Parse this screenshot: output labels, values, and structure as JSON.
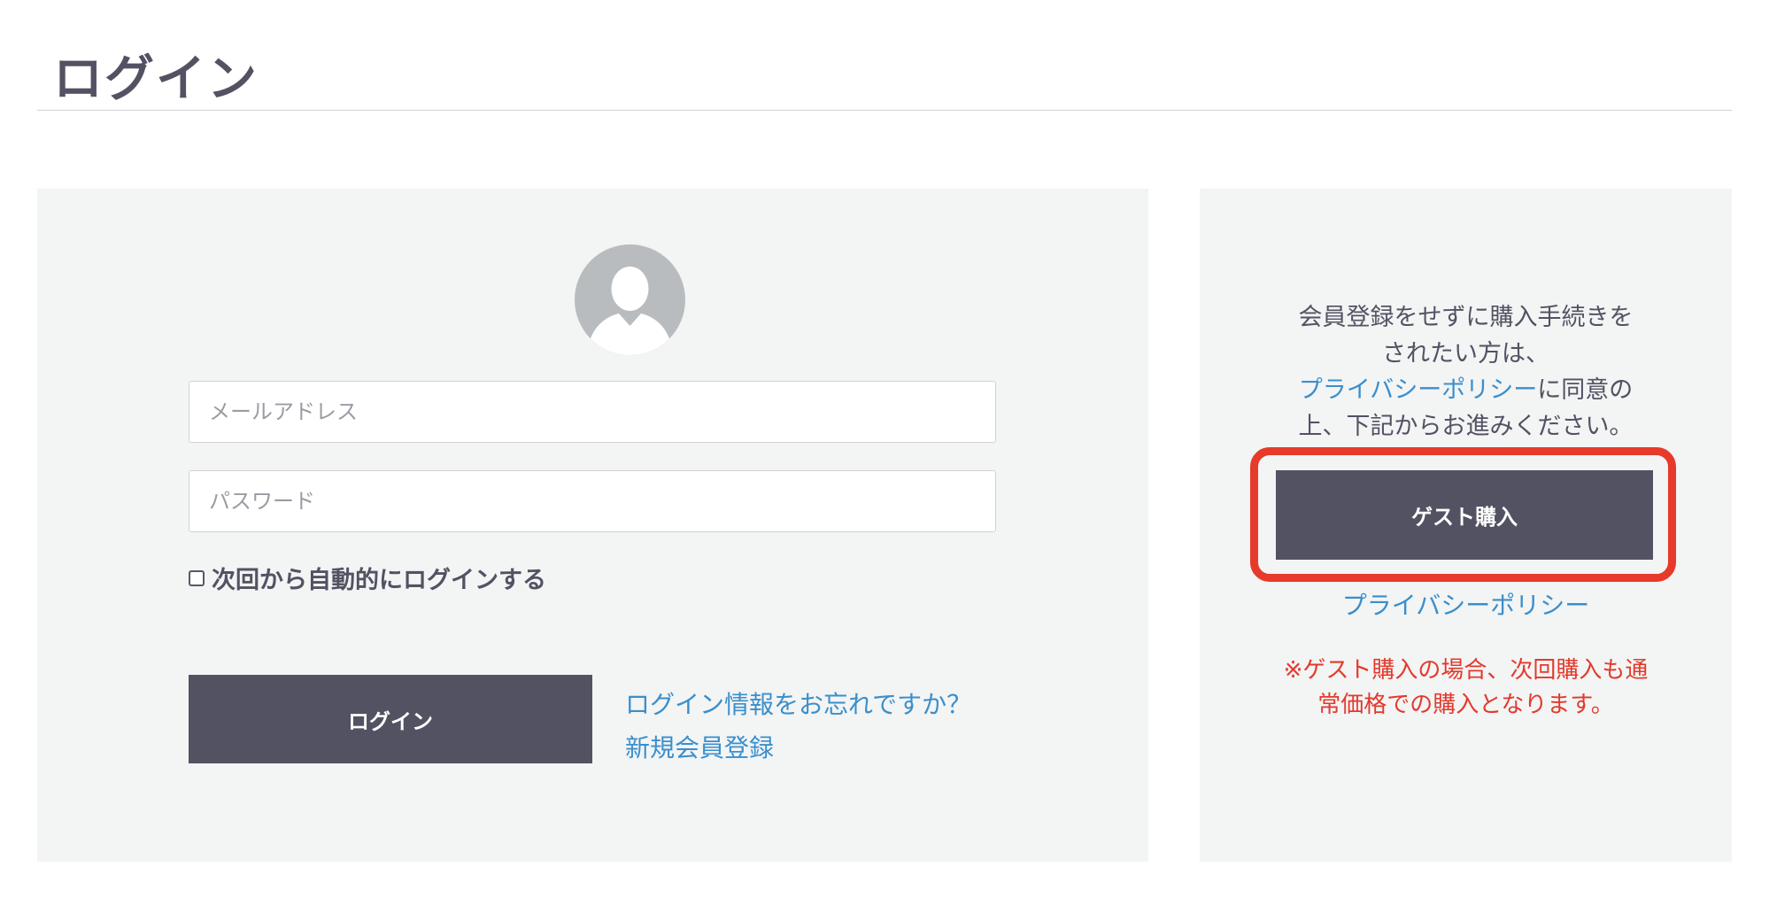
{
  "page": {
    "title": "ログイン"
  },
  "login_form": {
    "avatar_icon": "user-silhouette-icon",
    "email_placeholder": "メールアドレス",
    "password_placeholder": "パスワード",
    "remember_label": "次回から自動的にログインする",
    "remember_checked": false,
    "login_button_label": "ログイン",
    "forgot_link": "ログイン情報をお忘れですか？",
    "signup_link": "新規会員登録"
  },
  "guest": {
    "desc_line1": "会員登録をせずに購入手続きを",
    "desc_line2": "されたい方は、",
    "desc_link": "プライバシーポリシー",
    "desc_line3_suffix": "に同意の",
    "desc_line4": "上、下記からお進みください。",
    "button_label": "ゲスト購入",
    "privacy_link": "プライバシーポリシー",
    "note_line1": "※ゲスト購入の場合、次回購入も通",
    "note_line2": "常価格での購入となります。"
  },
  "colors": {
    "button_bg": "#525263",
    "panel_bg": "#f3f4f4",
    "link": "#3a8fcc",
    "highlight": "#e63a2a",
    "note": "#e23a2d"
  }
}
